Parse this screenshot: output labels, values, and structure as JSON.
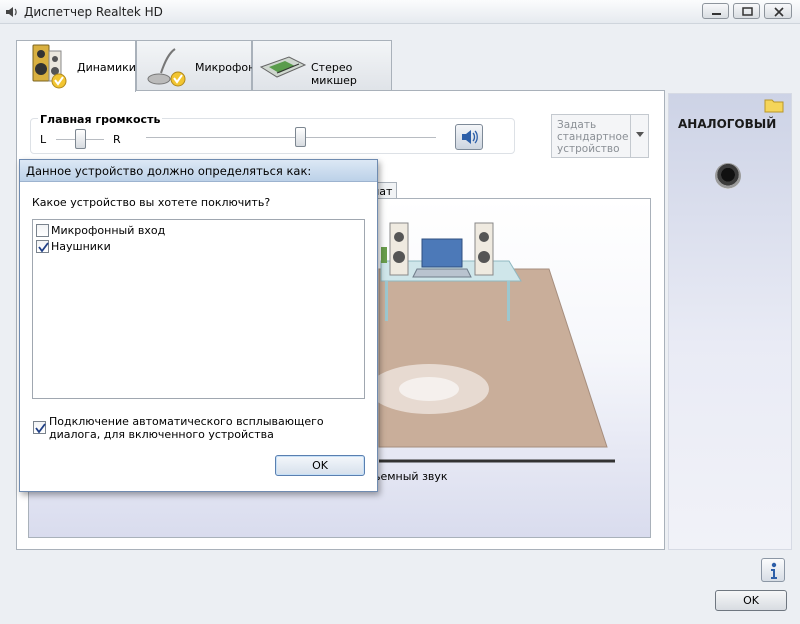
{
  "window": {
    "title": "Диспетчер Realtek HD"
  },
  "tabs": [
    {
      "label": "Динамики",
      "icon": "speakers-icon",
      "active": true
    },
    {
      "label": "Микрофон",
      "icon": "microphone-icon",
      "active": false
    },
    {
      "label": "Стерео микшер",
      "icon": "stereo-mixer-icon",
      "active": false
    }
  ],
  "volume": {
    "title": "Главная громкость",
    "left_label": "L",
    "right_label": "R",
    "balance": 0.5,
    "level": 0.6
  },
  "default_device": {
    "lines": [
      "Задать",
      "стандартное",
      "устройство"
    ]
  },
  "inner_tab_fragment": "мат",
  "room_caption_fragment": "ьемный звук",
  "right_panel": {
    "label": "АНАЛОГОВЫЙ"
  },
  "main_ok_label": "OK",
  "dialog": {
    "title": "Данное устройство должно определяться как:",
    "question": "Какое устройство вы хотете поключить?",
    "options": [
      {
        "label": "Микрофонный вход",
        "checked": false
      },
      {
        "label": "Наушники",
        "checked": true
      }
    ],
    "auto_popup": {
      "label": "Подключение автоматического всплывающего диалога, для включенного устройства",
      "checked": true
    },
    "ok_label": "OK"
  },
  "colors": {
    "dialog_title_bg": "#c7d8ec",
    "floor": "#c9ae9a",
    "right_panel_top": "#cdd3e6"
  }
}
